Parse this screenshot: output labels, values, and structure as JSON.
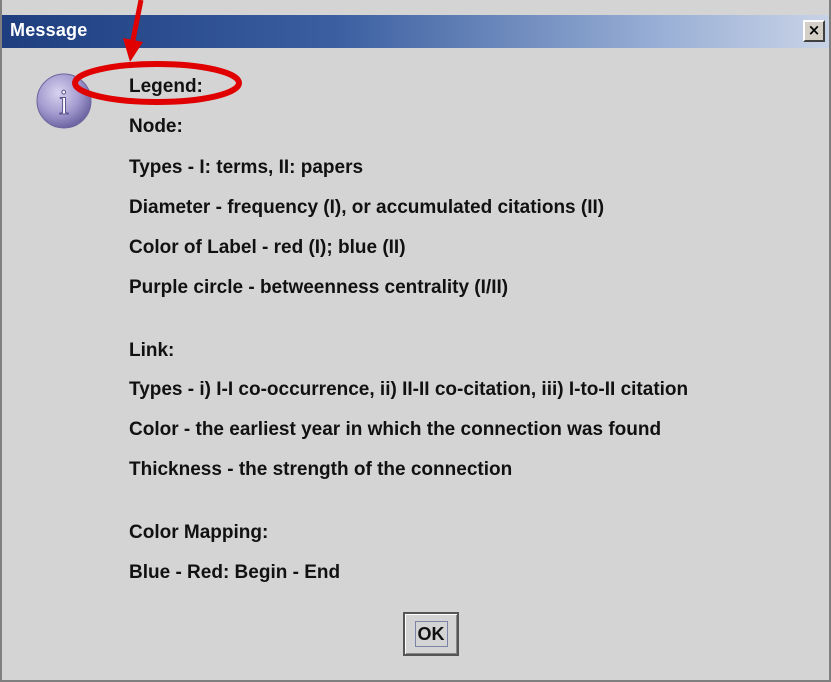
{
  "window": {
    "title": "Message",
    "close_glyph": "×"
  },
  "icon": {
    "name": "info-icon",
    "glyph": "i",
    "color": "#8f86bf"
  },
  "message_lines": [
    "Legend:",
    "Node:",
    "Types - I: terms, II: papers",
    "Diameter - frequency (I), or accumulated citations (II)",
    "Color of Label - red (I); blue (II)",
    "Purple circle - betweenness centrality (I/II)",
    "Link:",
    "Types - i) I-I co-occurrence, ii) II-II co-citation, iii) I-to-II citation",
    "Color - the earliest year in which the connection was found",
    "Thickness - the strength of the connection",
    "Color Mapping:",
    "Blue - Red: Begin - End"
  ],
  "buttons": {
    "ok_label": "OK"
  },
  "annotation": {
    "color": "#e00000",
    "arrow_icon": "red-arrow-icon",
    "circle_icon": "red-ellipse-highlight"
  },
  "colors": {
    "titlebar_start": "#1e3e7f",
    "dialog_background": "#d4d4d4"
  }
}
